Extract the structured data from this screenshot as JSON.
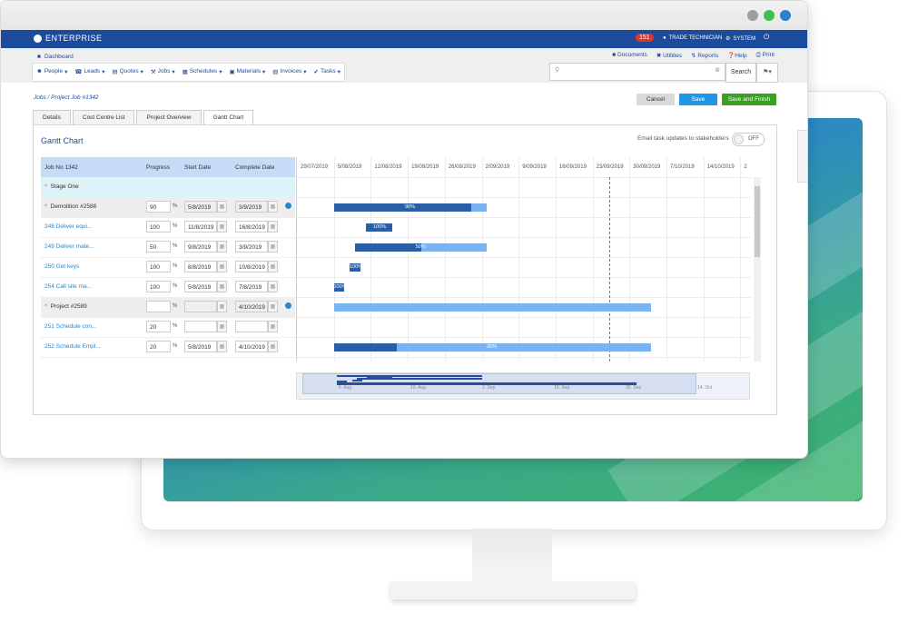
{
  "app": {
    "name": "ENTERPRISE",
    "notification_count": "151",
    "user_label": "TRADE TECHNICIAN",
    "system_label": "SYSTEM"
  },
  "nav": {
    "dashboard": "Dashboard",
    "menus": [
      "People",
      "Leads",
      "Quotes",
      "Jobs",
      "Schedules",
      "Materials",
      "Invoices",
      "Tasks"
    ],
    "right_links": [
      "Documents",
      "Utilities",
      "Reports",
      "Help",
      "Print"
    ],
    "search_button": "Search",
    "search_placeholder": ""
  },
  "breadcrumb": "Jobs / Project Job #1342",
  "actions": {
    "cancel": "Cancel",
    "save": "Save",
    "save_finish": "Save and Finish"
  },
  "tabs": [
    "Details",
    "Cost Centre List",
    "Project Overview",
    "Gantt Chart"
  ],
  "active_tab": "Gantt Chart",
  "gantt": {
    "title": "Gantt Chart",
    "email_label": "Email task updates to stakeholders",
    "toggle_state": "OFF",
    "columns": {
      "job": "Job No 1342",
      "progress": "Progress",
      "start": "Start Date",
      "complete": "Complete Date"
    },
    "stage": "Stage One",
    "rows": [
      {
        "name": "Demolition #2588",
        "group": true,
        "progress": "90",
        "start": "5/8/2019",
        "complete": "3/9/2019"
      },
      {
        "name": "248 Deliver equi...",
        "group": false,
        "progress": "100",
        "start": "11/8/2019",
        "complete": "16/8/2019"
      },
      {
        "name": "249 Deliver mate...",
        "group": false,
        "progress": "50",
        "start": "9/8/2019",
        "complete": "3/9/2019"
      },
      {
        "name": "250 Get keys",
        "group": false,
        "progress": "100",
        "start": "8/8/2019",
        "complete": "10/8/2019"
      },
      {
        "name": "254 Call site ma...",
        "group": false,
        "progress": "100",
        "start": "5/8/2019",
        "complete": "7/8/2019"
      },
      {
        "name": "Project #2589",
        "group": true,
        "progress": "",
        "start": "",
        "complete": "4/10/2019"
      },
      {
        "name": "251 Schedule con...",
        "group": false,
        "progress": "20",
        "start": "",
        "complete": ""
      },
      {
        "name": "252 Schedule Empl...",
        "group": false,
        "progress": "20",
        "start": "5/8/2019",
        "complete": "4/10/2019"
      }
    ],
    "dates": [
      "29/07/2019",
      "5/08/2019",
      "12/08/2019",
      "19/08/2019",
      "26/08/2019",
      "2/09/2019",
      "9/09/2019",
      "16/09/2019",
      "23/09/2019",
      "30/09/2019",
      "7/10/2019",
      "14/10/2019",
      "2"
    ],
    "bar_labels": [
      "90%",
      "100%",
      "50%",
      "100%",
      "100%",
      "20%"
    ],
    "navigator_labels": [
      "5. Aug",
      "19. Aug",
      "2. Sep",
      "16. Sep",
      "30. Sep",
      "14. Oct"
    ]
  },
  "chart_data": {
    "type": "gantt",
    "x_axis": "date",
    "today": "2019-09-24",
    "tasks": [
      {
        "name": "Demolition #2588",
        "start": "2019-08-05",
        "end": "2019-09-03",
        "progress": 90
      },
      {
        "name": "248 Deliver equi...",
        "start": "2019-08-11",
        "end": "2019-08-16",
        "progress": 100
      },
      {
        "name": "249 Deliver mate...",
        "start": "2019-08-09",
        "end": "2019-09-03",
        "progress": 50
      },
      {
        "name": "250 Get keys",
        "start": "2019-08-08",
        "end": "2019-08-10",
        "progress": 100
      },
      {
        "name": "254 Call site ma...",
        "start": "2019-08-05",
        "end": "2019-08-07",
        "progress": 100
      },
      {
        "name": "Project #2589",
        "start": "2019-08-05",
        "end": "2019-10-04",
        "progress": 0
      },
      {
        "name": "252 Schedule Empl...",
        "start": "2019-08-05",
        "end": "2019-10-04",
        "progress": 20
      }
    ]
  },
  "colors": {
    "brand": "#1d4b9c",
    "save": "#2196e6",
    "save_finish": "#3aa021",
    "bar_done": "#2a5fa8",
    "bar_remaining": "#7ab3f0"
  }
}
